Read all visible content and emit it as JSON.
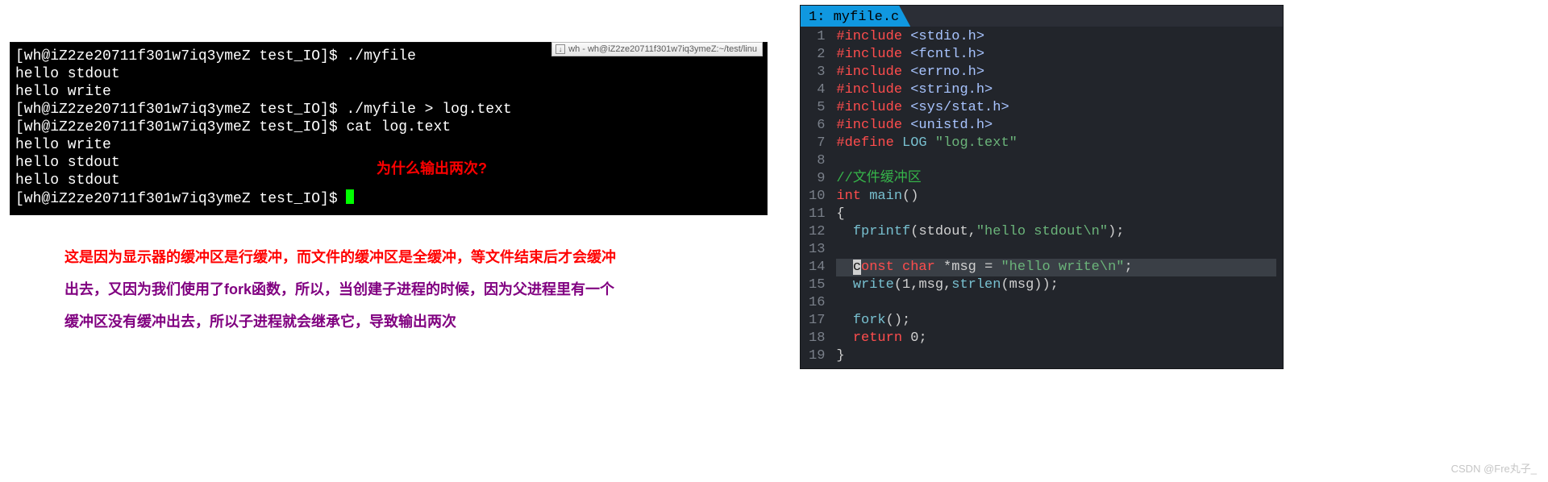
{
  "terminal": {
    "titlebar_icon": "↓",
    "titlebar_text": "wh - wh@iZ2ze20711f301w7iq3ymeZ:~/test/linu",
    "prompt": "[wh@iZ2ze20711f301w7iq3ymeZ test_IO]$ ",
    "cmd1": "./myfile",
    "out1": "hello stdout",
    "out2": "hello write",
    "cmd2": "./myfile > log.text",
    "cmd3": "cat log.text",
    "out3": "hello write",
    "out4": "hello stdout",
    "out5": "hello stdout",
    "annot": "为什么输出两次?"
  },
  "explanation": {
    "red": "这是因为显示器的缓冲区是行缓冲，而文件的缓冲区是全缓冲，等文件结束后才会缓冲",
    "purple1": "出去，又因为我们使用了fork函数，所以，当创建子进程的时候，因为父进程里有一个",
    "purple2": "缓冲区没有缓冲出去，所以子进程就会继承它，导致输出两次"
  },
  "editor": {
    "tab_index": "1",
    "tab_label": "myfile.c",
    "gutter": [
      "1",
      "2",
      "3",
      "4",
      "5",
      "6",
      "7",
      "8",
      "9",
      "10",
      "11",
      "12",
      "13",
      "14",
      "15",
      "16",
      "17",
      "18",
      "19"
    ],
    "code": {
      "inc1": "<stdio.h>",
      "inc2": "<fcntl.h>",
      "inc3": "<errno.h>",
      "inc4": "<string.h>",
      "inc5": "<sys/stat.h>",
      "inc6": "<unistd.h>",
      "def_name": "LOG",
      "def_val": "\"log.text\"",
      "comment": "//文件缓冲区",
      "main_sig": "main",
      "fprintf_call": "fprintf",
      "fprintf_args1": "stdout",
      "fprintf_str": "\"hello stdout\\n\"",
      "msg_decl_val": "\"hello write\\n\"",
      "write_call": "write",
      "strlen_call": "strlen",
      "fork_call": "fork",
      "ret_val": "0"
    }
  },
  "watermark": "CSDN @Fre丸子_"
}
